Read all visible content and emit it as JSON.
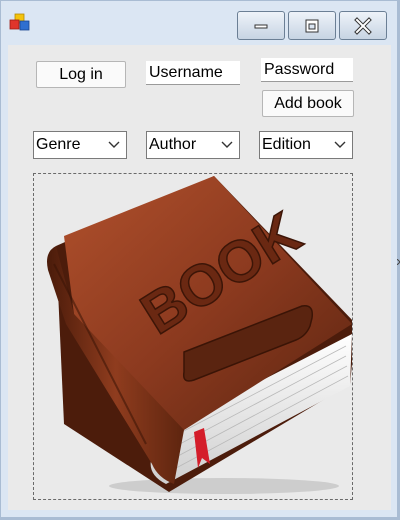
{
  "form": {
    "login_label": "Log in",
    "username_value": "Username",
    "password_value": "Password",
    "add_book_label": "Add book"
  },
  "filters": {
    "genre": "Genre",
    "author": "Author",
    "edition": "Edition"
  },
  "picture": {
    "icon": "book-icon",
    "cover_text": "BOOK"
  },
  "colors": {
    "window_frame": "#dbe6f3",
    "client_bg": "#eaeaea",
    "cover": "#8c3a1f",
    "cover_dark": "#5a2410",
    "bookmark": "#d41d2a"
  }
}
